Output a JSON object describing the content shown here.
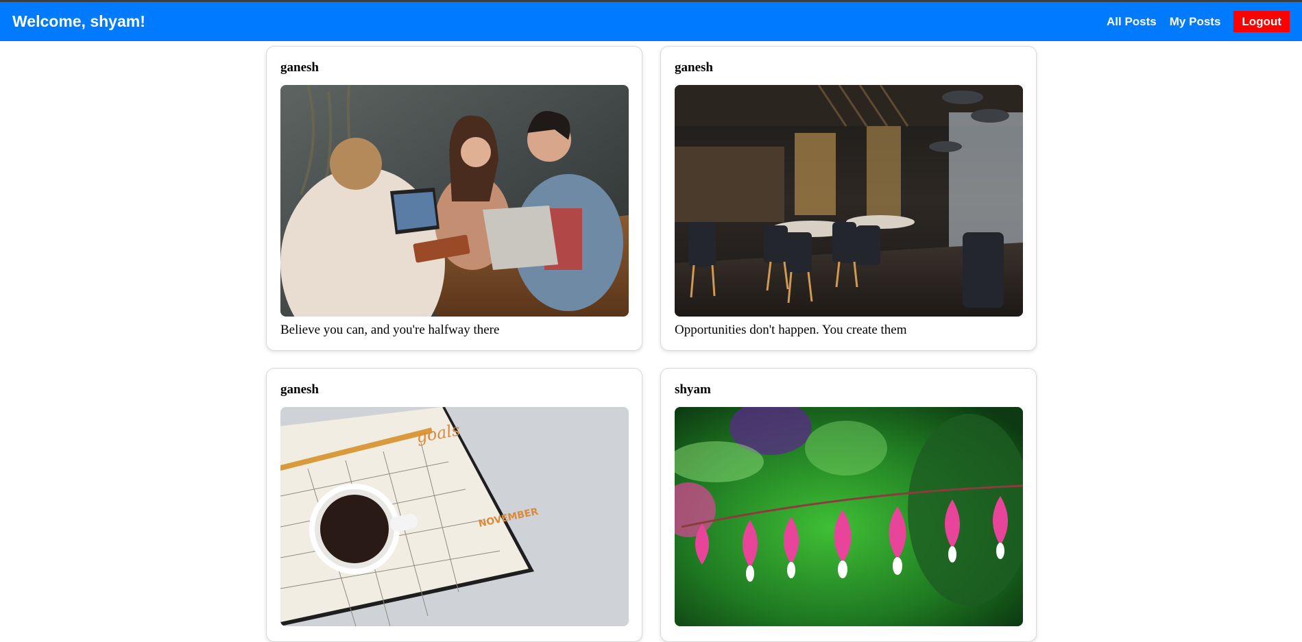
{
  "header": {
    "title": "Welcome, shyam!",
    "nav": {
      "all_posts": "All Posts",
      "my_posts": "My Posts",
      "logout": "Logout"
    },
    "colors": {
      "bar": "#007bff",
      "logout": "#ff0000"
    }
  },
  "posts": [
    {
      "author": "ganesh",
      "caption": "Believe you can, and you're halfway there",
      "image": "people-laughing-around-laptops-photo"
    },
    {
      "author": "ganesh",
      "caption": "Opportunities don't happen. You create them",
      "image": "restaurant-interior-photo"
    },
    {
      "author": "ganesh",
      "caption": "",
      "image": "coffee-cup-on-planner-photo"
    },
    {
      "author": "shyam",
      "caption": "",
      "image": "pink-bleeding-heart-flowers-photo"
    }
  ]
}
